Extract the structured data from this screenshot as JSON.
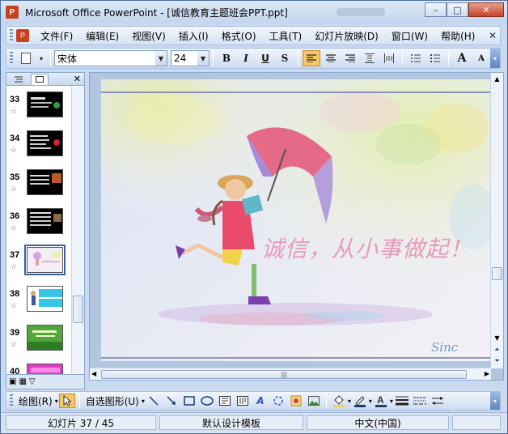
{
  "window": {
    "title": "Microsoft Office PowerPoint - [诚信教育主题班会PPT.ppt]",
    "app_icon_letter": "P",
    "minimize_glyph": "–",
    "maximize_glyph": "□",
    "close_glyph": "✕"
  },
  "menubar": {
    "items": [
      "文件(F)",
      "编辑(E)",
      "视图(V)",
      "插入(I)",
      "格式(O)",
      "工具(T)",
      "幻灯片放映(D)",
      "窗口(W)",
      "帮助(H)"
    ],
    "close_glyph": "✕"
  },
  "format_toolbar": {
    "font_name": "宋体",
    "font_size": "24",
    "bold": "B",
    "italic": "I",
    "underline": "U",
    "shadow": "S",
    "grow_font": "A",
    "shrink_font": "A"
  },
  "left_panel": {
    "close_glyph": "✕",
    "thumbnails": [
      {
        "number": "33"
      },
      {
        "number": "34"
      },
      {
        "number": "35"
      },
      {
        "number": "36"
      },
      {
        "number": "37",
        "selected": true
      },
      {
        "number": "38"
      },
      {
        "number": "39"
      },
      {
        "number": "40"
      }
    ]
  },
  "slide": {
    "caption": "诚信，从小事做起！",
    "signature": "Sinc"
  },
  "drawing_toolbar": {
    "draw_label": "绘图(R)",
    "autoshapes_label": "自选图形(U)"
  },
  "statusbar": {
    "slide_position": "幻灯片 37 / 45",
    "design_template": "默认设计模板",
    "language": "中文(中国)"
  },
  "colors": {
    "titlebar": "#c3d6ee",
    "selected_button": "#f7c86a",
    "caption": "#e79bbd",
    "close_button": "#c7432c"
  }
}
